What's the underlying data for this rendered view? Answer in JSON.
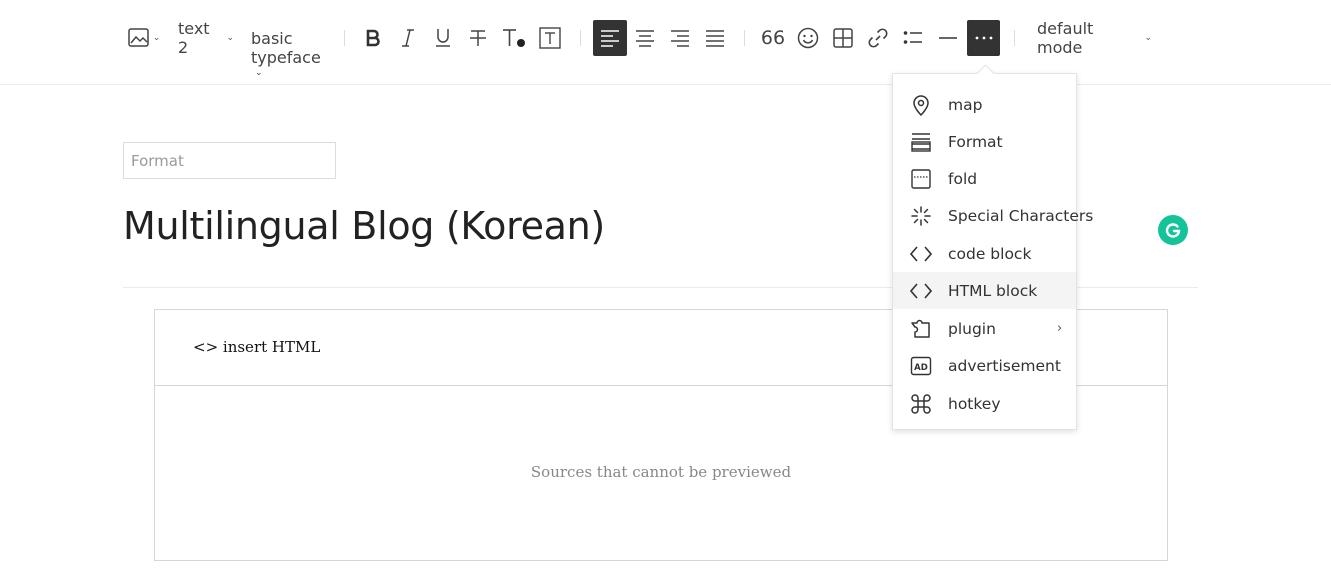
{
  "toolbar": {
    "image_icon": "image-icon",
    "text_style": "text 2",
    "typeface_line1": "basic",
    "typeface_line2": "typeface",
    "quote_label": "66",
    "mode_label": "default mode"
  },
  "editor": {
    "format_placeholder": "Format",
    "title": "Multilingual Blog (Korean)",
    "html_block_label": "<> insert HTML",
    "preview_note": "Sources that cannot be previewed"
  },
  "menu": {
    "items": [
      {
        "label": "map",
        "icon": "map-pin-icon"
      },
      {
        "label": "Format",
        "icon": "format-icon"
      },
      {
        "label": "fold",
        "icon": "fold-icon"
      },
      {
        "label": "Special Characters",
        "icon": "special-characters-icon"
      },
      {
        "label": "code block",
        "icon": "code-icon"
      },
      {
        "label": "HTML block",
        "icon": "html-icon"
      },
      {
        "label": "plugin",
        "icon": "plugin-icon"
      },
      {
        "label": "advertisement",
        "icon": "ad-icon"
      },
      {
        "label": "hotkey",
        "icon": "command-icon"
      }
    ]
  },
  "colors": {
    "active_button": "#333333",
    "grammarly": "#15c39a",
    "menu_hover": "#f4f4f4"
  }
}
